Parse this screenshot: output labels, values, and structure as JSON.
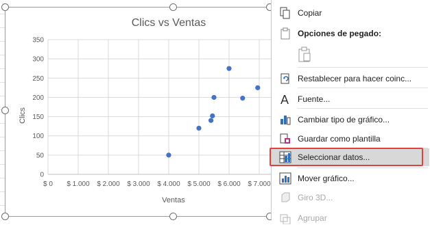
{
  "chart_data": {
    "type": "scatter",
    "title": "Clics vs Ventas",
    "xlabel": "Ventas",
    "ylabel": "Clics",
    "xlim": [
      0,
      7000
    ],
    "ylim": [
      0,
      350
    ],
    "x_ticks": [
      "$ 0",
      "$ 1.000",
      "$ 2.000",
      "$ 3.000",
      "$ 4.000",
      "$ 5.000",
      "$ 6.000",
      "$ 7.000"
    ],
    "y_ticks": [
      "0",
      "50",
      "100",
      "150",
      "200",
      "250",
      "300",
      "350"
    ],
    "grid": true,
    "marker_color": "#4472c4",
    "points": [
      {
        "x": 4000,
        "y": 50
      },
      {
        "x": 5000,
        "y": 120
      },
      {
        "x": 5400,
        "y": 140
      },
      {
        "x": 5450,
        "y": 152
      },
      {
        "x": 5500,
        "y": 200
      },
      {
        "x": 6000,
        "y": 275
      },
      {
        "x": 6450,
        "y": 198
      },
      {
        "x": 6950,
        "y": 225
      }
    ]
  },
  "menu": {
    "copy": "Copiar",
    "paste_options": "Opciones de pegado:",
    "reset": "Restablecer para hacer coinc...",
    "font": "Fuente...",
    "change_type": "Cambiar tipo de gráfico...",
    "save_template": "Guardar como plantilla",
    "select_data": "Seleccionar datos...",
    "move_chart": "Mover gráfico...",
    "rotate_3d": "Giro 3D...",
    "group": "Agrupar"
  },
  "colors": {
    "highlight_border": "#e0413b",
    "menu_hover": "#d8d8d8",
    "accent": "#4472c4"
  }
}
